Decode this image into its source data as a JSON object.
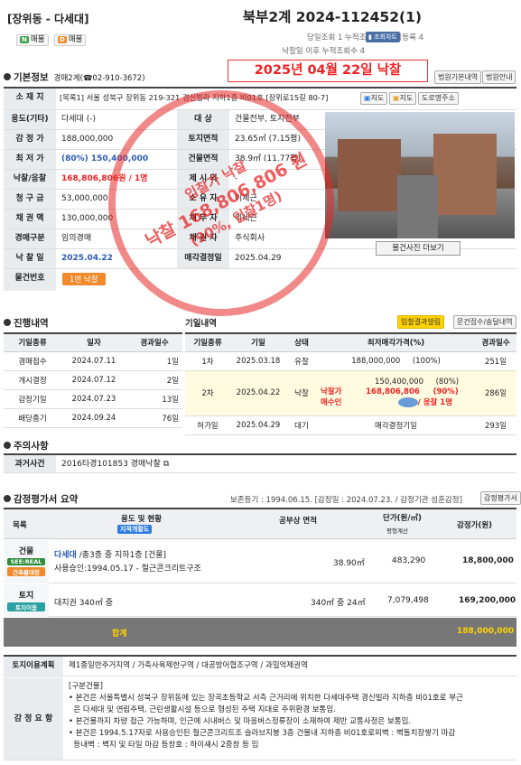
{
  "header": {
    "location": "[장위동 - 다세대]",
    "tag1": "매물",
    "tag1_badge": "N",
    "tag2": "매물",
    "tag2_badge": "D",
    "case_no": "북부2계 2024-112452(1)",
    "stats": "당일조회 1   누적조회 96   관심등록 4",
    "view_chart": "조회차트",
    "stats2": "낙찰일 이후 누적조회수 4",
    "result_banner": "2025년 04월 22일 낙찰"
  },
  "basic": {
    "title": "기본정보",
    "court": "경매2계(☎02-910-3672)",
    "btn_court": "법원기본내역",
    "btn_court_notice": "법원안내",
    "address_label": "소 재 지",
    "address": "[목록1] 서울 성북구 장위동 219-321 경신빌라 지하1층 비01호 [장위로15길 80-7]",
    "btn_map1": "지도",
    "btn_map2": "지도",
    "btn_road": "도로명주소",
    "rows": [
      {
        "l": "용도(기타)",
        "v": "다세대 (-)",
        "l2": "대    상",
        "v2": "건물전부, 토지전부"
      },
      {
        "l": "감 정 가",
        "v": "188,000,000",
        "l2": "토지면적",
        "v2": "23.65㎡ (7.15평)"
      },
      {
        "l": "최 저 가",
        "v": "(80%) 150,400,000",
        "l2": "건물면적",
        "v2": "38.9㎡ (11.77평)"
      },
      {
        "l": "낙찰/응찰",
        "v": "168,806,806원 / 1명",
        "l2": "제 시 외",
        "v2": "-"
      },
      {
        "l": "청 구 금",
        "v": "53,000,000",
        "l2": "소 유 자",
        "v2": "이제근"
      },
      {
        "l": "채 권 액",
        "v": "130,000,000",
        "l2": "채 무 자",
        "v2": "이세근"
      },
      {
        "l": "경매구분",
        "v": "임의경매",
        "l2": "채 권 자",
        "v2": "주식회사"
      },
      {
        "l": "낙 찰 일",
        "v": "2025.04.22",
        "l2": "매각결정일",
        "v2": "2025.04.29"
      }
    ],
    "item_no_label": "물건번호",
    "item_no": "1번 낙찰",
    "photo_btn": "물건사진 더보기"
  },
  "stamp": {
    "line1": "입찰가 낙찰",
    "line2": "낙찰 168,806,806 원",
    "line3": "(90%, 입찰1명)"
  },
  "progress": {
    "title": "진행내역",
    "title2": "기일내역",
    "btn_result": "입찰결과알림",
    "btn_doc": "문건접수/송달내역",
    "headers": [
      "기일종류",
      "일자",
      "경과일수"
    ],
    "rows": [
      [
        "경매접수",
        "2024.07.11",
        "1일"
      ],
      [
        "개시결정",
        "2024.07.12",
        "2일"
      ],
      [
        "감정기일",
        "2024.07.23",
        "13일"
      ],
      [
        "배당종기",
        "2024.09.24",
        "76일"
      ]
    ],
    "headers2": [
      "기일종류",
      "기일",
      "상태",
      "최저매각가격(%)",
      "경과일수"
    ],
    "rows2": [
      {
        "k": "1차",
        "d": "2025.03.18",
        "s": "유찰",
        "p": "188,000,000",
        "pct": "(100%)",
        "e": "251일"
      },
      {
        "k": "2차",
        "d": "2025.04.22",
        "s": "낙찰",
        "p": "150,400,000",
        "pct": "(80%)",
        "e": "286일"
      },
      {
        "k": "허가일",
        "d": "2025.04.29",
        "s": "대기",
        "p": "매각결정기일",
        "pct": "",
        "e": "293일"
      }
    ],
    "win_label": "낙찰가",
    "win_value": "168,806,806",
    "win_pct": "(90%)",
    "buyer_label": "매수인",
    "bid_count": "/ 응찰 1명"
  },
  "notice": {
    "title": "주의사항",
    "label": "과거사건",
    "value": "2016타경101853 경매낙찰"
  },
  "appraisal": {
    "title": "감정평가서 요약",
    "summary": "보존등기 : 1994.06.15. [감정일 : 2024.07.23. / 감정기관 성훈감정]",
    "btn": "감정평가서",
    "headers": {
      "item": "목록",
      "use": "용도 및 현황",
      "use_btn": "지적개황도",
      "area": "공부상   면적",
      "unit": "단가(원/㎡)",
      "unit_sub": "평형계산",
      "price": "감정가(원)"
    },
    "rows": [
      {
        "name": "건물",
        "badge1": "SEE:REAL",
        "badge2": "건축물대장",
        "use": "다세대",
        "use2": " /총3층 중 지하1층 [건물]",
        "sub": "사용승인:1994.05.17 - 철근콘크리트구조",
        "area": "38.90㎡",
        "unit": "483,290",
        "price": "18,800,000"
      },
      {
        "name": "토지",
        "badge1": "토지이음",
        "badge2": "",
        "use": "대지권 340㎡ 중",
        "use2": "",
        "sub": "",
        "area": "340㎡ 중 24㎡",
        "unit": "7,079,498",
        "price": "169,200,000"
      }
    ],
    "total_label": "합계",
    "total": "188,000,000"
  },
  "land": {
    "label": "토지이용계획",
    "value": "제1종일반주거지역 / 가축사육제한구역 / 대공방어협조구역 / 과밀억제권역"
  },
  "review": {
    "label": "감 정 요 항",
    "title": "[구분건물]",
    "lines": [
      "• 본건은 서울특별시 성북구 장위동에 있는 장곡초등학교 서측 근거리에 위치한 다세대주택 경신빌라 지하층 비01호로 부근",
      "  은 다세대 및 연립주택, 근린생활시설 등으로 형성된 주택 지대로 주위환경 보통임.",
      "• 본건물까지 차량 접근 가능하며, 인근에 시내버스 및 마을버스정류장이 소재하여 제반 교통사정은 보통임.",
      "• 본건은 1994.5.17자로 사용승인된 철근콘크리트조 슬라브지붕 3층 건물내 지하층 비01호로외벽 : 벽돌치장쌓기 마감",
      "  등내벽 : 벽지 및 타일 마감 등창호 : 하이섀시 2중창 등 임"
    ]
  },
  "colors": {
    "accent": "#e22",
    "green": "#2e8b3a",
    "orange": "#f08a2c",
    "total_bg": "#777"
  }
}
